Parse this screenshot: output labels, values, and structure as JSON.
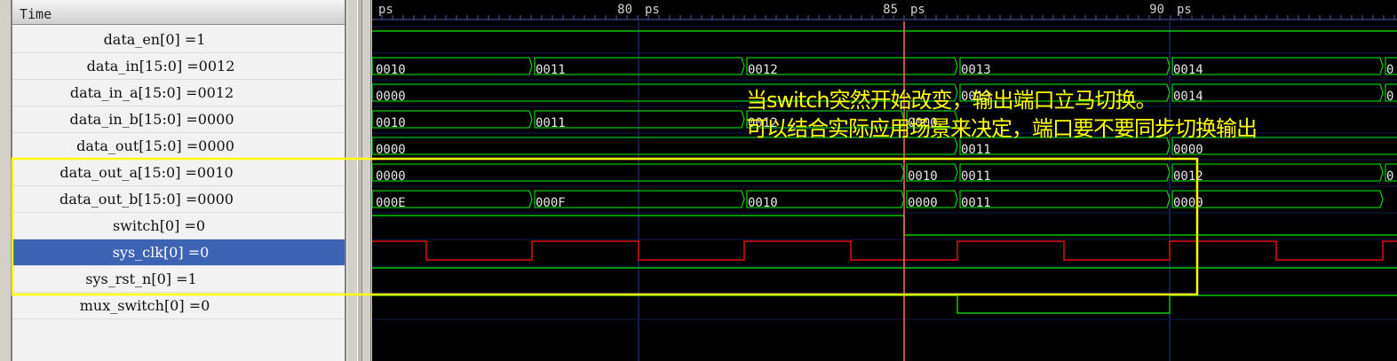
{
  "signal_panel": {
    "header": "Time",
    "signals": [
      {
        "label": "data_en[0] =1"
      },
      {
        "label": "data_in[15:0] =0012"
      },
      {
        "label": "data_in_a[15:0] =0012"
      },
      {
        "label": "data_in_b[15:0] =0000"
      },
      {
        "label": "data_out[15:0] =0000"
      },
      {
        "label": "data_out_a[15:0] =0010"
      },
      {
        "label": "data_out_b[15:0] =0000"
      },
      {
        "label": "switch[0] =0"
      },
      {
        "label": "sys_clk[0] =0"
      },
      {
        "label": "sys_rst_n[0] =1"
      },
      {
        "label": "mux_switch[0] =0"
      }
    ],
    "selected_signal": "sys_clk[0] =0"
  },
  "timeline": {
    "unit": "ps",
    "tick_labels": [
      "80",
      "85",
      "90"
    ]
  },
  "waveform_values": {
    "data_in": [
      "0010",
      "0011",
      "0012",
      "0013",
      "0014",
      "0"
    ],
    "data_in_a": [
      "0000",
      "0013",
      "0014",
      "0"
    ],
    "data_in_b": [
      "0010",
      "0011",
      "0012",
      "0000"
    ],
    "data_out": [
      "0000",
      "0011",
      "0000"
    ],
    "data_out_a": [
      "0000",
      "0010",
      "0011",
      "0012",
      "0"
    ],
    "data_out_b": [
      "000E",
      "000F",
      "0010",
      "0000",
      "0011",
      "0000"
    ]
  },
  "annotation": {
    "line1": "当switch突然开始改变，输出端口立马切换。",
    "line2": "可以结合实际应用场景来决定，端口要不要同步切换输出"
  },
  "colors": {
    "wave": "#00c800",
    "clock": "#e01010",
    "cursor": "#ff6a5a",
    "highlight_box": "#ffff00",
    "annotation_text": "#ffff00",
    "selection": "#3d63b4"
  }
}
